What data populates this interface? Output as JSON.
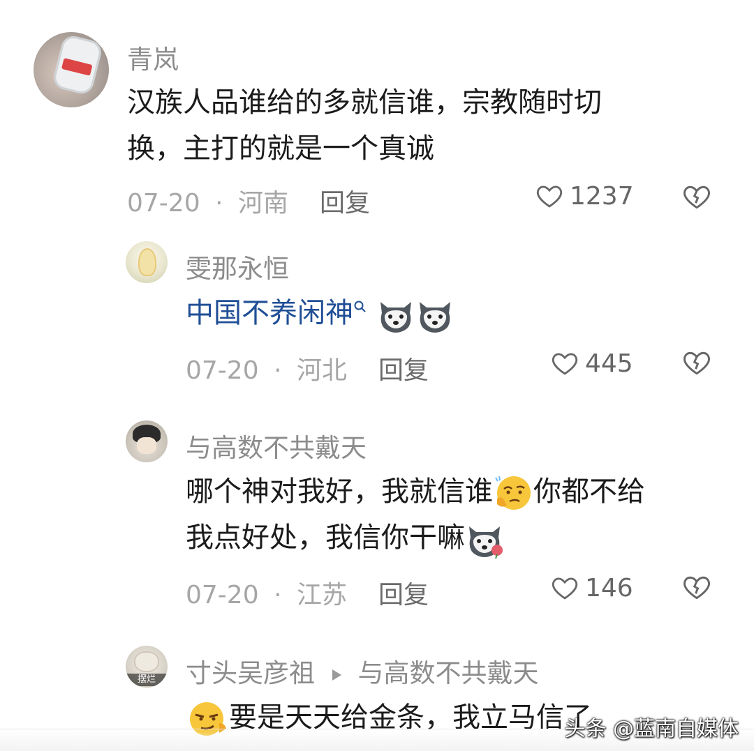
{
  "comments": [
    {
      "username": "青岚",
      "text": "汉族人品谁给的多就信谁，宗教随时切换，主打的就是一个真诚",
      "text_line1": "汉族人品谁给的多就信谁，宗教随时切",
      "text_line2": "换，主打的就是一个真诚",
      "date": "07-20",
      "sep": "·",
      "region": "河南",
      "reply_label": "回复",
      "likes": "1237",
      "avatar_icon": "bottle-photo-avatar"
    },
    {
      "username": "雯那永恒",
      "text": "中国不养闲神",
      "search_icon": "search-icon",
      "emojis": [
        "husky-emoji",
        "husky-emoji"
      ],
      "date": "07-20",
      "sep": "·",
      "region": "河北",
      "reply_label": "回复",
      "likes": "445",
      "avatar_icon": "flower-photo-avatar"
    },
    {
      "username": "与高数不共戴天",
      "text_line1_a": "哪个神对我好，我就信谁",
      "text_line1_b": "你都不给",
      "text_line2": "我点好处，我信你干嘛",
      "emojis": [
        "thinking-emoji",
        "husky-rose-emoji"
      ],
      "date": "07-20",
      "sep": "·",
      "region": "江苏",
      "reply_label": "回复",
      "likes": "146",
      "avatar_icon": "anime-boy-avatar"
    },
    {
      "username": "寸头吴彦祖",
      "reply_to": "与高数不共戴天",
      "avatar_caption": "摆烂",
      "text": "要是天天给金条，我立马信了",
      "emojis": [
        "smirk-emoji"
      ]
    }
  ],
  "watermark": "头条 @蓝南自媒体"
}
